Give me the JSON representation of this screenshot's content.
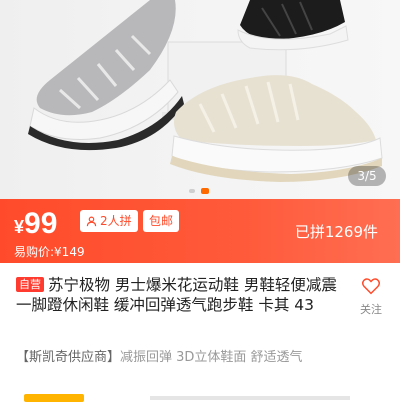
{
  "gallery": {
    "counter": "3/5",
    "dot_count": 2,
    "active_dot": 1
  },
  "price_bar": {
    "currency": "¥",
    "price": "99",
    "group_badge": "2人拼",
    "shipping_badge": "包邮",
    "easybuy_price": "易购价:¥149",
    "joined_count": "已拼1269件",
    "gradient_start": "#ff4b2b",
    "gradient_end": "#ff6e52"
  },
  "product": {
    "self_tag": "自营",
    "title": "苏宁极物 男士爆米花运动鞋 男鞋轻便减震一脚蹬休闲鞋 缓冲回弹透气跑步鞋 卡其 43",
    "follow_label": "关注",
    "promo_brand": "【斯凯奇供应商】",
    "promo_text": "减振回弹 3D立体鞋面 舒适透气"
  },
  "colors": {
    "accent": "#ff4b2b",
    "dot_active": "#ff6a00"
  },
  "icons": {
    "follow": "heart-icon",
    "group": "person-icon"
  }
}
